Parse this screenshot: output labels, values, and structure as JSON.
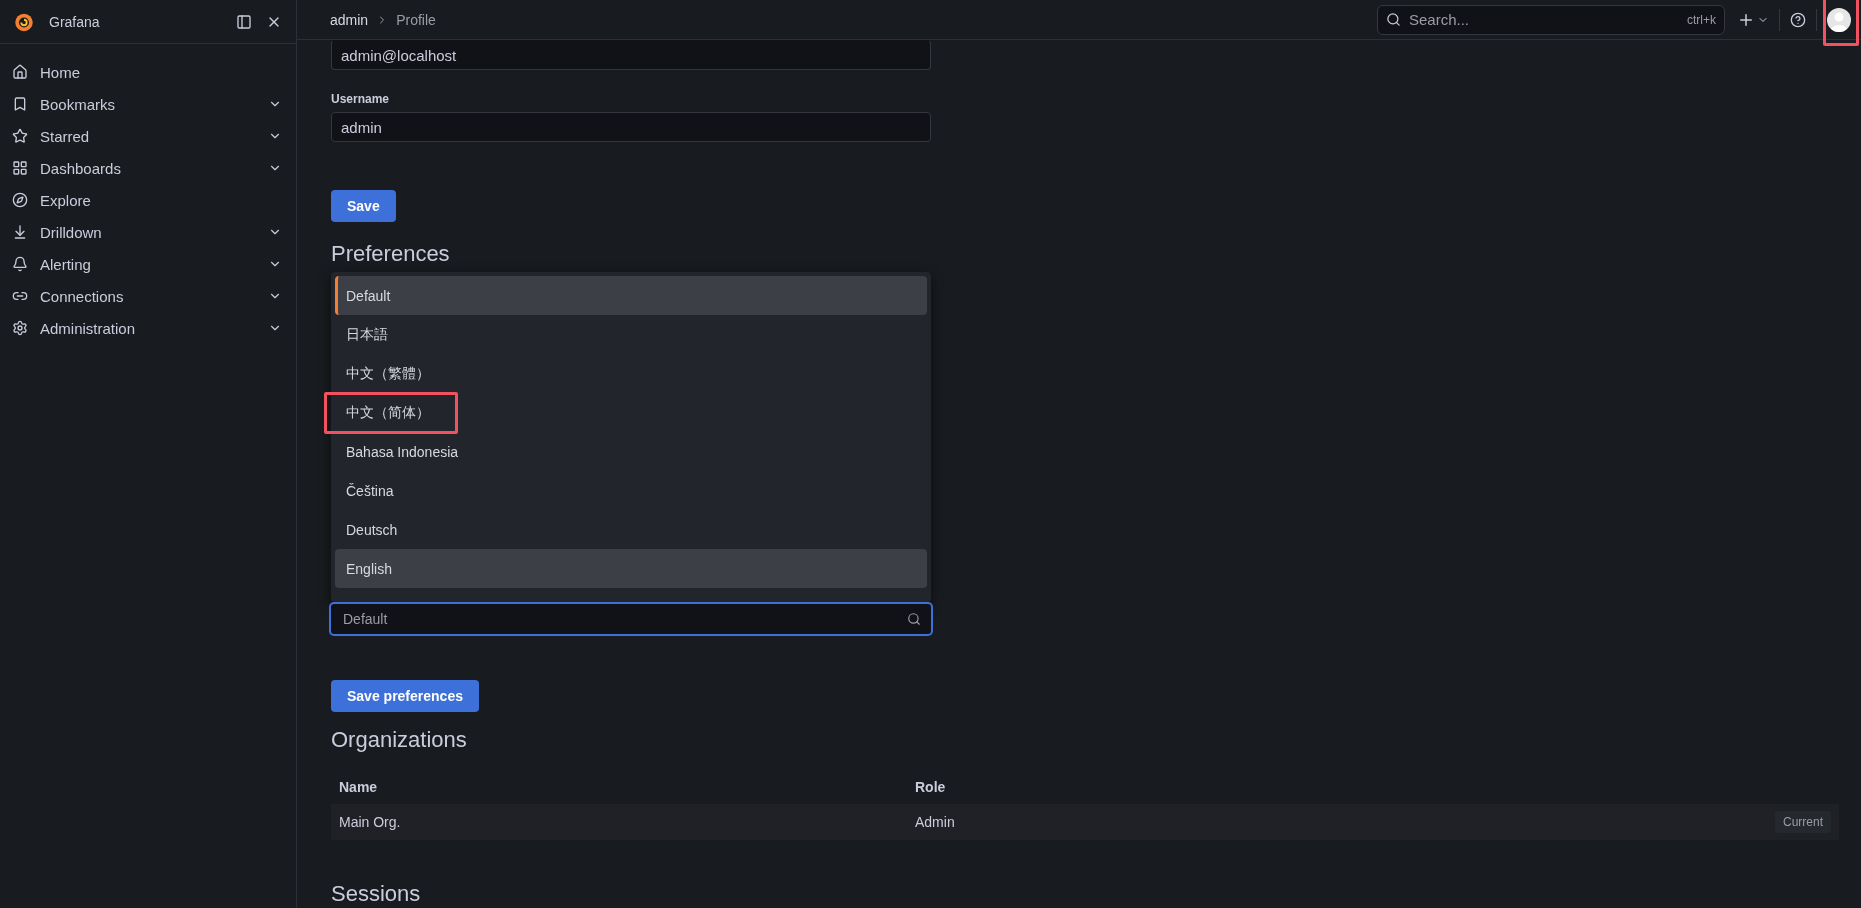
{
  "sidebar": {
    "brand": "Grafana",
    "items": [
      {
        "kind": "home",
        "label": "Home",
        "expandable": false
      },
      {
        "kind": "bookmark",
        "label": "Bookmarks",
        "expandable": true
      },
      {
        "kind": "star",
        "label": "Starred",
        "expandable": true
      },
      {
        "kind": "grid",
        "label": "Dashboards",
        "expandable": true
      },
      {
        "kind": "compass",
        "label": "Explore",
        "expandable": false
      },
      {
        "kind": "drill",
        "label": "Drilldown",
        "expandable": true
      },
      {
        "kind": "bell",
        "label": "Alerting",
        "expandable": true
      },
      {
        "kind": "link",
        "label": "Connections",
        "expandable": true
      },
      {
        "kind": "gear",
        "label": "Administration",
        "expandable": true
      }
    ]
  },
  "breadcrumb": [
    "admin",
    "Profile"
  ],
  "topbar": {
    "search_placeholder": "Search...",
    "shortcut": "ctrl+k",
    "avatar_highlighted": true
  },
  "profile": {
    "email": "admin@localhost",
    "username_label": "Username",
    "username": "admin",
    "save": "Save"
  },
  "preferences": {
    "heading": "Preferences",
    "language_options": [
      {
        "label": "Default",
        "selected": true,
        "focused": false,
        "highlighted": false
      },
      {
        "label": "日本語",
        "selected": false,
        "focused": false,
        "highlighted": false
      },
      {
        "label": "中文（繁體）",
        "selected": false,
        "focused": false,
        "highlighted": false
      },
      {
        "label": "中文（简体）",
        "selected": false,
        "focused": false,
        "highlighted": true
      },
      {
        "label": "Bahasa Indonesia",
        "selected": false,
        "focused": false,
        "highlighted": false
      },
      {
        "label": "Čeština",
        "selected": false,
        "focused": false,
        "highlighted": false
      },
      {
        "label": "Deutsch",
        "selected": false,
        "focused": false,
        "highlighted": false
      },
      {
        "label": "English",
        "selected": false,
        "focused": true,
        "highlighted": false
      }
    ],
    "language_placeholder": "Default",
    "save": "Save preferences"
  },
  "organizations": {
    "heading": "Organizations",
    "columns": [
      "Name",
      "Role"
    ],
    "rows": [
      {
        "name": "Main Org.",
        "role": "Admin",
        "badge": "Current"
      }
    ]
  },
  "sessions": {
    "heading": "Sessions"
  }
}
